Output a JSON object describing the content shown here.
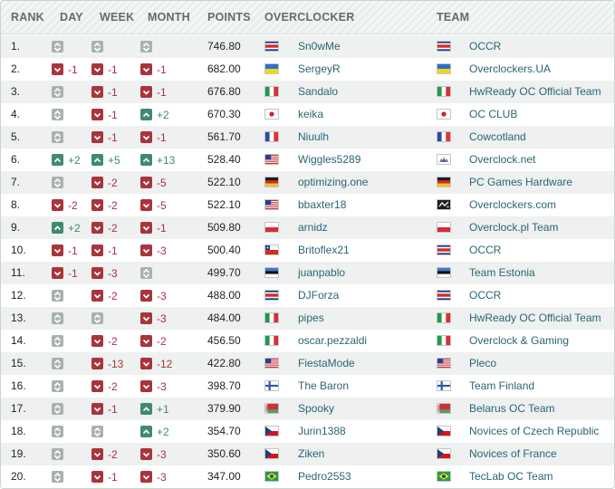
{
  "headers": {
    "rank": "RANK",
    "day": "DAY",
    "week": "WEEK",
    "month": "MONTH",
    "points": "POINTS",
    "overclocker": "OVERCLOCKER",
    "team": "TEAM"
  },
  "colors": {
    "up": "#3f8a71",
    "down": "#a8343c",
    "neutral": "#a8b2b0",
    "link": "#2a6475"
  },
  "rows": [
    {
      "rank": "1.",
      "day": {
        "dir": "neutral",
        "text": ""
      },
      "week": {
        "dir": "neutral",
        "text": ""
      },
      "month": {
        "dir": "neutral",
        "text": ""
      },
      "points": "746.80",
      "user": "Sn0wMe",
      "user_flag": "costa-rica-flag",
      "team": "OCCR",
      "team_flag": "costa-rica-flag"
    },
    {
      "rank": "2.",
      "day": {
        "dir": "down",
        "text": "-1"
      },
      "week": {
        "dir": "down",
        "text": "-1"
      },
      "month": {
        "dir": "down",
        "text": "-1"
      },
      "points": "682.00",
      "user": "SergeyR",
      "user_flag": "ukraine-flag",
      "team": "Overclockers.UA",
      "team_flag": "ukraine-flag"
    },
    {
      "rank": "3.",
      "day": {
        "dir": "neutral",
        "text": ""
      },
      "week": {
        "dir": "down",
        "text": "-1"
      },
      "month": {
        "dir": "down",
        "text": "-1"
      },
      "points": "676.80",
      "user": "Sandalo",
      "user_flag": "italy-flag",
      "team": "HwReady OC Official Team",
      "team_flag": "italy-flag"
    },
    {
      "rank": "4.",
      "day": {
        "dir": "neutral",
        "text": ""
      },
      "week": {
        "dir": "down",
        "text": "-1"
      },
      "month": {
        "dir": "up",
        "text": "+2"
      },
      "points": "670.30",
      "user": "keika",
      "user_flag": "japan-flag",
      "team": "OC CLUB",
      "team_flag": "japan-flag"
    },
    {
      "rank": "5.",
      "day": {
        "dir": "neutral",
        "text": ""
      },
      "week": {
        "dir": "down",
        "text": "-1"
      },
      "month": {
        "dir": "down",
        "text": "-1"
      },
      "points": "561.70",
      "user": "Niuulh",
      "user_flag": "france-flag",
      "team": "Cowcotland",
      "team_flag": "france-flag"
    },
    {
      "rank": "6.",
      "day": {
        "dir": "up",
        "text": "+2"
      },
      "week": {
        "dir": "up",
        "text": "+5"
      },
      "month": {
        "dir": "up",
        "text": "+13"
      },
      "points": "528.40",
      "user": "Wiggles5289",
      "user_flag": "usa-flag",
      "team": "Overclock.net",
      "team_flag": "overclock-net-logo"
    },
    {
      "rank": "7.",
      "day": {
        "dir": "neutral",
        "text": ""
      },
      "week": {
        "dir": "down",
        "text": "-2"
      },
      "month": {
        "dir": "down",
        "text": "-5"
      },
      "points": "522.10",
      "user": "optimizing.one",
      "user_flag": "germany-flag",
      "team": "PC Games Hardware",
      "team_flag": "germany-flag"
    },
    {
      "rank": "8.",
      "day": {
        "dir": "down",
        "text": "-2"
      },
      "week": {
        "dir": "down",
        "text": "-2"
      },
      "month": {
        "dir": "down",
        "text": "-5"
      },
      "points": "522.10",
      "user": "bbaxter18",
      "user_flag": "usa-flag",
      "team": "Overclockers.com",
      "team_flag": "overclockers-com-logo"
    },
    {
      "rank": "9.",
      "day": {
        "dir": "up",
        "text": "+2"
      },
      "week": {
        "dir": "down",
        "text": "-2"
      },
      "month": {
        "dir": "down",
        "text": "-1"
      },
      "points": "509.80",
      "user": "arnidz",
      "user_flag": "poland-flag",
      "team": "Overclock.pl Team",
      "team_flag": "poland-flag"
    },
    {
      "rank": "10.",
      "day": {
        "dir": "down",
        "text": "-1"
      },
      "week": {
        "dir": "down",
        "text": "-1"
      },
      "month": {
        "dir": "down",
        "text": "-3"
      },
      "points": "500.40",
      "user": "Britoflex21",
      "user_flag": "chile-flag",
      "team": "OCCR",
      "team_flag": "costa-rica-flag"
    },
    {
      "rank": "11.",
      "day": {
        "dir": "down",
        "text": "-1"
      },
      "week": {
        "dir": "down",
        "text": "-3"
      },
      "month": {
        "dir": "neutral",
        "text": ""
      },
      "points": "499.70",
      "user": "juanpablo",
      "user_flag": "estonia-flag",
      "team": "Team Estonia",
      "team_flag": "estonia-flag"
    },
    {
      "rank": "12.",
      "day": {
        "dir": "neutral",
        "text": ""
      },
      "week": {
        "dir": "down",
        "text": "-2"
      },
      "month": {
        "dir": "down",
        "text": "-3"
      },
      "points": "488.00",
      "user": "DJForza",
      "user_flag": "costa-rica-flag",
      "team": "OCCR",
      "team_flag": "costa-rica-flag"
    },
    {
      "rank": "13.",
      "day": {
        "dir": "neutral",
        "text": ""
      },
      "week": {
        "dir": "neutral",
        "text": ""
      },
      "month": {
        "dir": "down",
        "text": "-3"
      },
      "points": "484.00",
      "user": "pipes",
      "user_flag": "italy-flag",
      "team": "HwReady OC Official Team",
      "team_flag": "italy-flag"
    },
    {
      "rank": "14.",
      "day": {
        "dir": "neutral",
        "text": ""
      },
      "week": {
        "dir": "down",
        "text": "-2"
      },
      "month": {
        "dir": "down",
        "text": "-2"
      },
      "points": "456.50",
      "user": "oscar.pezzaldi",
      "user_flag": "italy-flag",
      "team": "Overclock & Gaming",
      "team_flag": "italy-flag"
    },
    {
      "rank": "15.",
      "day": {
        "dir": "neutral",
        "text": ""
      },
      "week": {
        "dir": "down",
        "text": "-13"
      },
      "month": {
        "dir": "down",
        "text": "-12"
      },
      "points": "422.80",
      "user": "FiestaMode",
      "user_flag": "usa-flag",
      "team": "Pleco",
      "team_flag": "usa-flag"
    },
    {
      "rank": "16.",
      "day": {
        "dir": "neutral",
        "text": ""
      },
      "week": {
        "dir": "down",
        "text": "-2"
      },
      "month": {
        "dir": "down",
        "text": "-3"
      },
      "points": "398.70",
      "user": "The Baron",
      "user_flag": "finland-flag",
      "team": "Team Finland",
      "team_flag": "finland-flag"
    },
    {
      "rank": "17.",
      "day": {
        "dir": "neutral",
        "text": ""
      },
      "week": {
        "dir": "down",
        "text": "-1"
      },
      "month": {
        "dir": "up",
        "text": "+1"
      },
      "points": "379.90",
      "user": "Spooky",
      "user_flag": "belarus-flag",
      "team": "Belarus OC Team",
      "team_flag": "belarus-flag"
    },
    {
      "rank": "18.",
      "day": {
        "dir": "neutral",
        "text": ""
      },
      "week": {
        "dir": "neutral",
        "text": ""
      },
      "month": {
        "dir": "up",
        "text": "+2"
      },
      "points": "354.70",
      "user": "Jurin1388",
      "user_flag": "czech-flag",
      "team": "Novices of Czech Republic",
      "team_flag": "czech-flag"
    },
    {
      "rank": "19.",
      "day": {
        "dir": "neutral",
        "text": ""
      },
      "week": {
        "dir": "down",
        "text": "-2"
      },
      "month": {
        "dir": "down",
        "text": "-3"
      },
      "points": "350.60",
      "user": "Ziken",
      "user_flag": "czech-flag",
      "team": "Novices of France",
      "team_flag": "czech-flag"
    },
    {
      "rank": "20.",
      "day": {
        "dir": "neutral",
        "text": ""
      },
      "week": {
        "dir": "down",
        "text": "-1"
      },
      "month": {
        "dir": "down",
        "text": "-3"
      },
      "points": "347.00",
      "user": "Pedro2553",
      "user_flag": "brazil-flag",
      "team": "TecLab OC Team",
      "team_flag": "brazil-flag"
    }
  ]
}
